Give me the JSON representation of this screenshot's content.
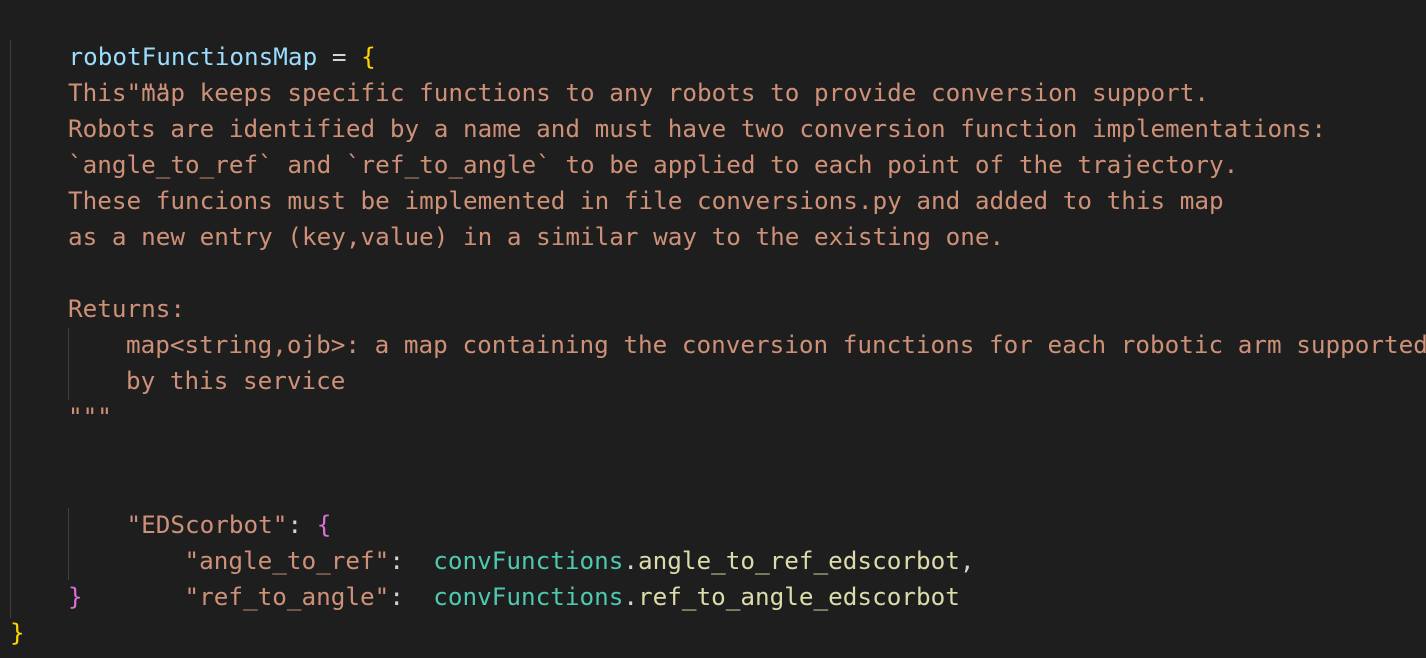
{
  "code": {
    "line1": {
      "name": "robotFunctionsMap",
      "op": " = ",
      "open": "{"
    },
    "doc_open": "\"\"\"",
    "doc_lines": [
      "This map keeps specific functions to any robots to provide conversion support.",
      "Robots are identified by a name and must have two conversion function implementations:",
      "`angle_to_ref` and `ref_to_angle` to be applied to each point of the trajectory.",
      "These funcions must be implemented in file conversions.py and added to this map",
      "as a new entry (key,value) in a similar way to the existing one."
    ],
    "returns_label": "Returns:",
    "returns_lines": [
      "map<string,ojb>: a map containing the conversion functions for each robotic arm supported",
      "by this service"
    ],
    "doc_close": "\"\"\"",
    "entry_key": "\"EDScorbot\"",
    "entry_colon": ": ",
    "entry_open": "{",
    "items": [
      {
        "key": "\"angle_to_ref\"",
        "sep": ":  ",
        "module": "convFunctions",
        "dot": ".",
        "func": "angle_to_ref_edscorbot",
        "trail": ","
      },
      {
        "key": "\"ref_to_angle\"",
        "sep": ":  ",
        "module": "convFunctions",
        "dot": ".",
        "func": "ref_to_angle_edscorbot",
        "trail": ""
      }
    ],
    "entry_close": "}",
    "close": "}"
  },
  "colors": {
    "background": "#1e1e1e",
    "variable": "#9cdcfe",
    "string": "#ce9178",
    "brace_level1": "#ffd700",
    "brace_level2": "#da70d6",
    "module": "#4ec9b0",
    "function": "#dcdcaa"
  }
}
